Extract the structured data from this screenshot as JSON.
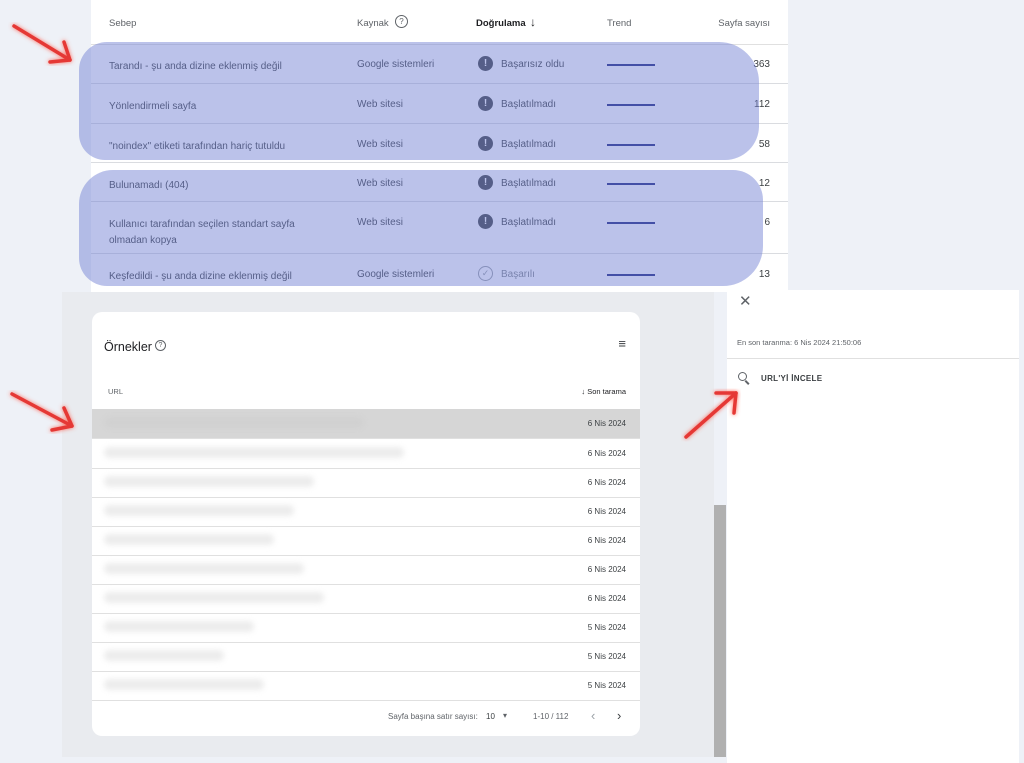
{
  "issues_table": {
    "headers": {
      "sebep": "Sebep",
      "kaynak": "Kaynak",
      "dogrulama": "Doğrulama",
      "trend": "Trend",
      "sayfa": "Sayfa sayısı"
    },
    "rows": [
      {
        "sebep": "Tarandı - şu anda dizine eklenmiş değil",
        "kaynak": "Google sistemleri",
        "dogrulama": "Başarısız oldu",
        "status_icon": "error-icon",
        "sayfa": "363"
      },
      {
        "sebep": "Yönlendirmeli sayfa",
        "kaynak": "Web sitesi",
        "dogrulama": "Başlatılmadı",
        "status_icon": "error-icon",
        "sayfa": "112"
      },
      {
        "sebep": "\"noindex\" etiketi tarafından hariç tutuldu",
        "kaynak": "Web sitesi",
        "dogrulama": "Başlatılmadı",
        "status_icon": "error-icon",
        "sayfa": "58"
      },
      {
        "sebep": "Bulunamadı (404)",
        "kaynak": "Web sitesi",
        "dogrulama": "Başlatılmadı",
        "status_icon": "error-icon",
        "sayfa": "12"
      },
      {
        "sebep": "Kullanıcı tarafından seçilen standart sayfa olmadan kopya",
        "kaynak": "Web sitesi",
        "dogrulama": "Başlatılmadı",
        "status_icon": "error-icon",
        "sayfa": "6"
      },
      {
        "sebep": "Keşfedildi - şu anda dizine eklenmiş değil",
        "kaynak": "Google sistemleri",
        "dogrulama": "Başarılı",
        "status_icon": "check-icon",
        "sayfa": "13"
      }
    ]
  },
  "examples": {
    "title": "Örnekler",
    "col_url": "URL",
    "col_son": "Son tarama",
    "rows": [
      "6 Nis 2024",
      "6 Nis 2024",
      "6 Nis 2024",
      "6 Nis 2024",
      "6 Nis 2024",
      "6 Nis 2024",
      "6 Nis 2024",
      "5 Nis 2024",
      "5 Nis 2024",
      "5 Nis 2024"
    ],
    "pager": {
      "label": "Sayfa başına satır sayısı:",
      "value": "10",
      "range": "1-10 / 112"
    }
  },
  "panel": {
    "crawl_text": "En son taranma: 6 Nis 2024 21:50:06",
    "inspect_label": "URL'Yİ İNCELE"
  },
  "colors": {
    "highlight": "#7080d4",
    "arrow": "#e53935",
    "status_icon": "#3c4043"
  }
}
